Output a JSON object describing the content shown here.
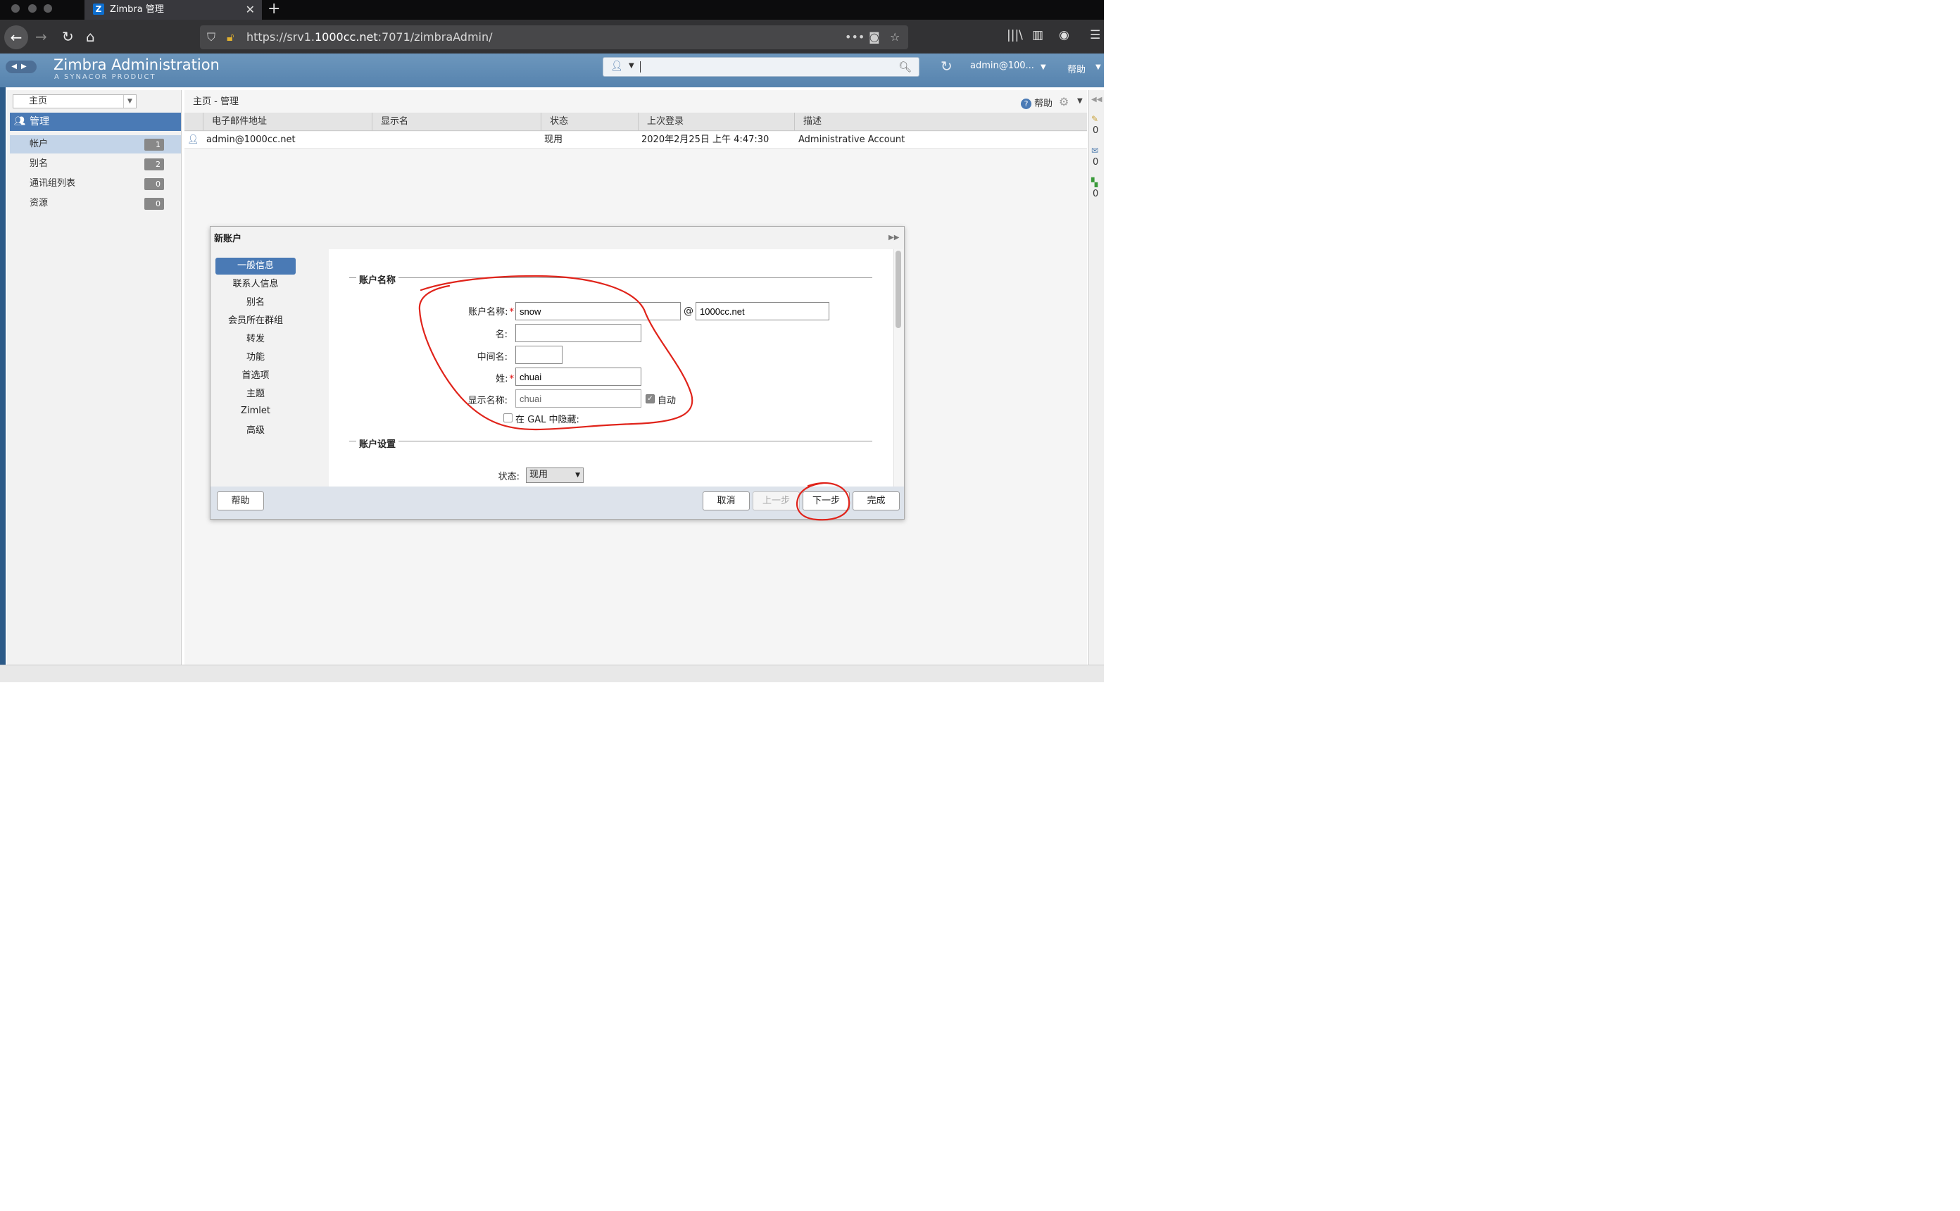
{
  "browser": {
    "tab_title": "Zimbra 管理",
    "tab_icon_letter": "Z",
    "url_prefix": "https://srv1.",
    "url_host": "1000cc.net",
    "url_suffix": ":7071/zimbraAdmin/"
  },
  "header": {
    "logo": "Zimbra Administration",
    "sublogo": "A SYNACOR PRODUCT",
    "user": "admin@100...",
    "help": "帮助"
  },
  "sidebar": {
    "home": "主页",
    "section": "管理",
    "items": [
      {
        "label": "帐户",
        "count": "1"
      },
      {
        "label": "别名",
        "count": "2"
      },
      {
        "label": "通讯组列表",
        "count": "0"
      },
      {
        "label": "资源",
        "count": "0"
      }
    ]
  },
  "content": {
    "breadcrumb": "主页 - 管理",
    "help": "帮助",
    "columns": [
      "电子邮件地址",
      "显示名",
      "状态",
      "上次登录",
      "描述"
    ],
    "rows": [
      {
        "email": "admin@1000cc.net",
        "display": "",
        "status": "现用",
        "last_login": "2020年2月25日 上午 4:47:30",
        "desc": "Administrative Account"
      }
    ]
  },
  "rail": {
    "counts": [
      "0",
      "0",
      "0"
    ]
  },
  "dialog": {
    "title": "新账户",
    "nav": [
      "一般信息",
      "联系人信息",
      "别名",
      "会员所在群组",
      "转发",
      "功能",
      "首选项",
      "主题",
      "Zimlet",
      "高级"
    ],
    "section1": "账户名称",
    "section2": "账户设置",
    "labels": {
      "account_name": "账户名称:",
      "first_name": "名:",
      "middle_name": "中间名:",
      "last_name": "姓:",
      "display_name": "显示名称:",
      "auto": "自动",
      "hide_gal": "在 GAL 中隐藏:",
      "status": "状态:"
    },
    "values": {
      "account_name": "snow",
      "domain": "1000cc.net",
      "first_name": "",
      "middle_name": "",
      "last_name": "chuai",
      "display_name": "chuai",
      "status": "现用"
    },
    "buttons": {
      "help": "帮助",
      "cancel": "取消",
      "prev": "上一步",
      "next": "下一步",
      "finish": "完成"
    }
  },
  "colors": {
    "accent": "#4a7ab5",
    "annotation": "#e0231a"
  }
}
